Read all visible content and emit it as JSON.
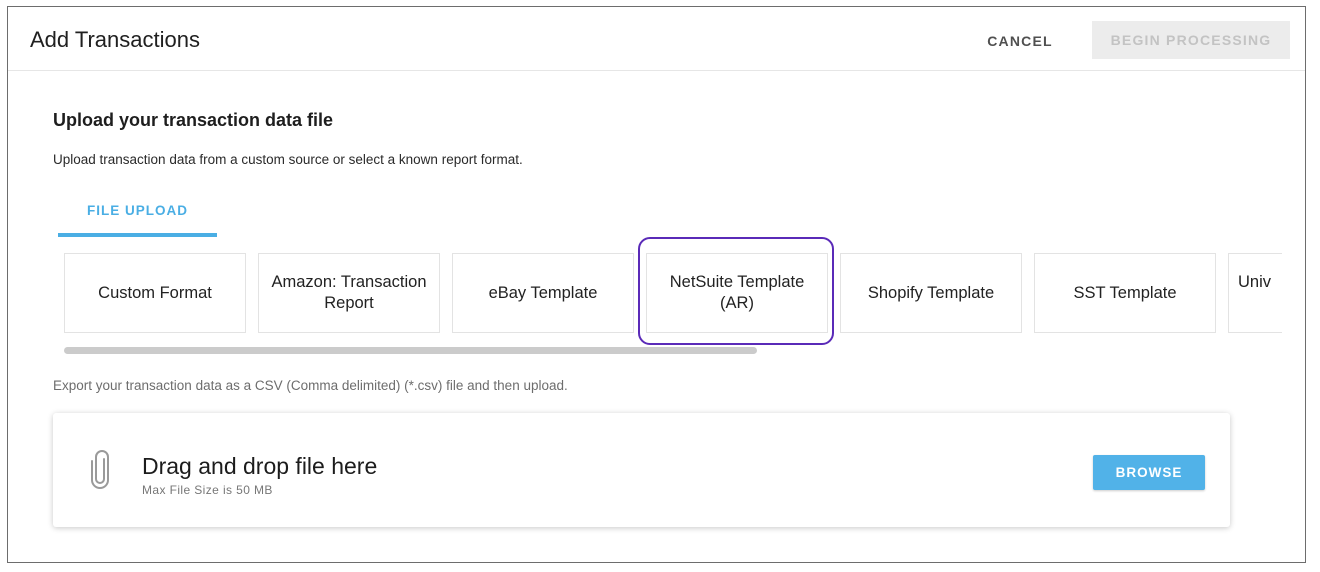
{
  "header": {
    "title": "Add Transactions",
    "cancel_label": "CANCEL",
    "begin_label": "BEGIN PROCESSING"
  },
  "upload": {
    "title": "Upload your transaction data file",
    "subtitle": "Upload transaction data from a custom source or select a known report format.",
    "tab_label": "FILE UPLOAD"
  },
  "formats": [
    {
      "label": "Custom Format"
    },
    {
      "label": "Amazon: Transaction Report"
    },
    {
      "label": "eBay Template"
    },
    {
      "label": "NetSuite Template (AR)"
    },
    {
      "label": "Shopify Template"
    },
    {
      "label": "SST Template"
    },
    {
      "label": "Univ"
    }
  ],
  "highlighted_format": "NetSuite Template (AR)",
  "export_note": "Export your transaction data as a CSV (Comma delimited) (*.csv) file and then upload.",
  "dropzone": {
    "main_text": "Drag and drop file here",
    "size_text": "Max File Size is 50 MB",
    "browse_label": "BROWSE",
    "icon": "paperclip-icon"
  },
  "colors": {
    "accent": "#4aaee4",
    "highlight_border": "#5a2ab8",
    "disabled_bg": "#ececec"
  }
}
